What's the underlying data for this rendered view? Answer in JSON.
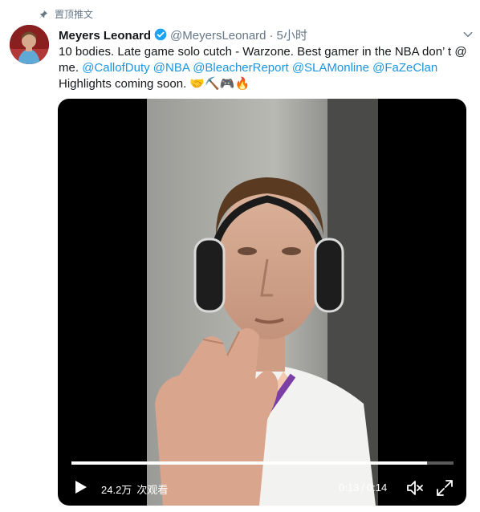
{
  "pinned": {
    "label": "置顶推文"
  },
  "author": {
    "name": "Meyers Leonard",
    "handle": "@MeyersLeonard",
    "separator": "·",
    "time": "5小时"
  },
  "tweet": {
    "text_1": "10 bodies. Late game solo cutch - Warzone. Best gamer in the NBA don’ t @ me. ",
    "mention_1": "@CallofDuty",
    "mention_2": "@NBA",
    "mention_3": "@BleacherReport",
    "mention_4": "@SLAMonline",
    "mention_5": "@FaZeClan",
    "text_2": " Highlights coming soon. ",
    "emojis": "🤝⛏️🎮🔥"
  },
  "video": {
    "views": "24.2万",
    "views_label": "次观看",
    "current_time": "0:13",
    "time_separator": "/",
    "duration": "0:14",
    "progress_fraction": 0.93
  },
  "colors": {
    "link": "#1b95e0",
    "verified": "#1da1f2",
    "muted_text": "#657786"
  },
  "icons": [
    "pin-icon",
    "verified-badge-icon",
    "chevron-down-icon",
    "play-icon",
    "volume-muted-icon",
    "fullscreen-icon"
  ]
}
